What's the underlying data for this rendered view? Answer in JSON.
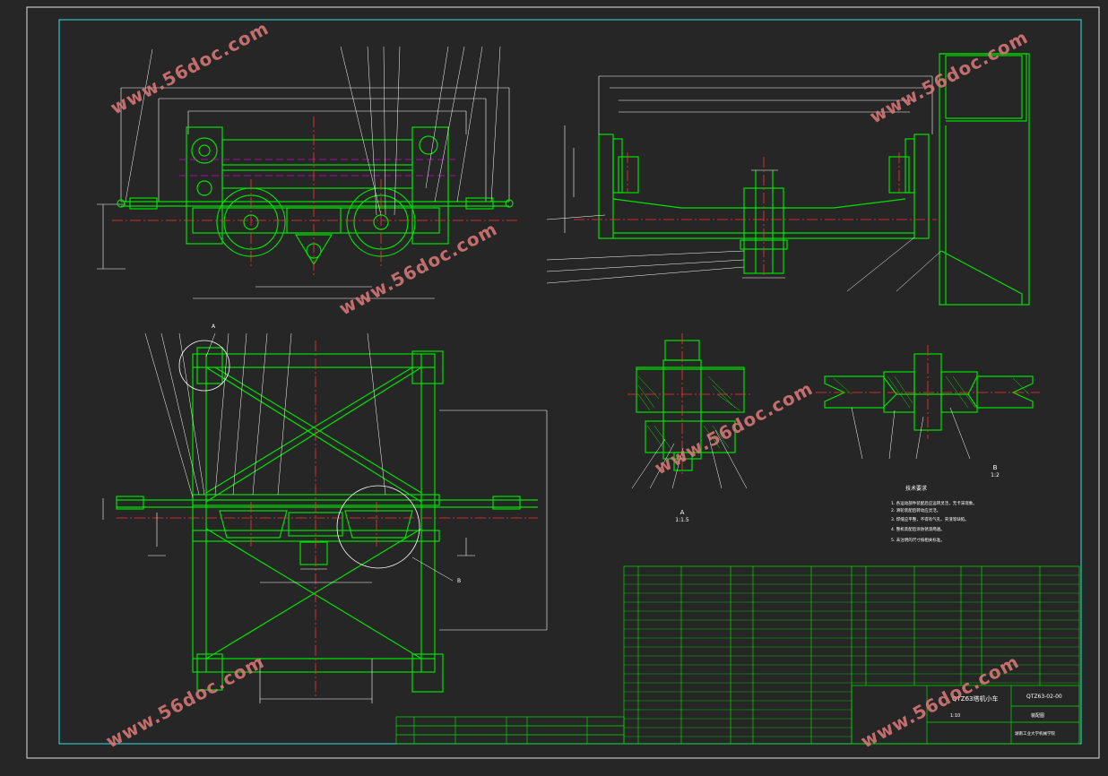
{
  "title_block": {
    "drawing_name": "QTZ63塔机小车",
    "drawing_number": "QTZ63-02-00",
    "scale_label": "1:10",
    "assembly_label": "装配图",
    "school_label": "湖南工业大学机械学院"
  },
  "views": {
    "section_a_label": "A",
    "section_a_scale": "1:1.5",
    "section_b_label": "B",
    "section_b_scale": "1:2",
    "callout_a": "A",
    "callout_b": "B"
  },
  "tech_requirements": {
    "heading": "技术要求",
    "items": [
      "1. 各运动部件装配后应运转灵活，无卡滞现象。",
      "2. 滑轮装配后转动应灵活。",
      "3. 焊缝应平整，不得有气孔、夹渣等缺陷。",
      "4. 整机装配后涂防锈漆两遍。",
      "5. 未注明的尺寸按相关标准。"
    ]
  },
  "watermark": "www.56doc.com",
  "colors": {
    "background": "#262626",
    "frame": "#ffffff",
    "geometry": "#00e000",
    "centerline": "#ff3030",
    "hidden": "#d000d0",
    "inner_frame": "#30e0e0",
    "watermark": "#e07a7a"
  }
}
